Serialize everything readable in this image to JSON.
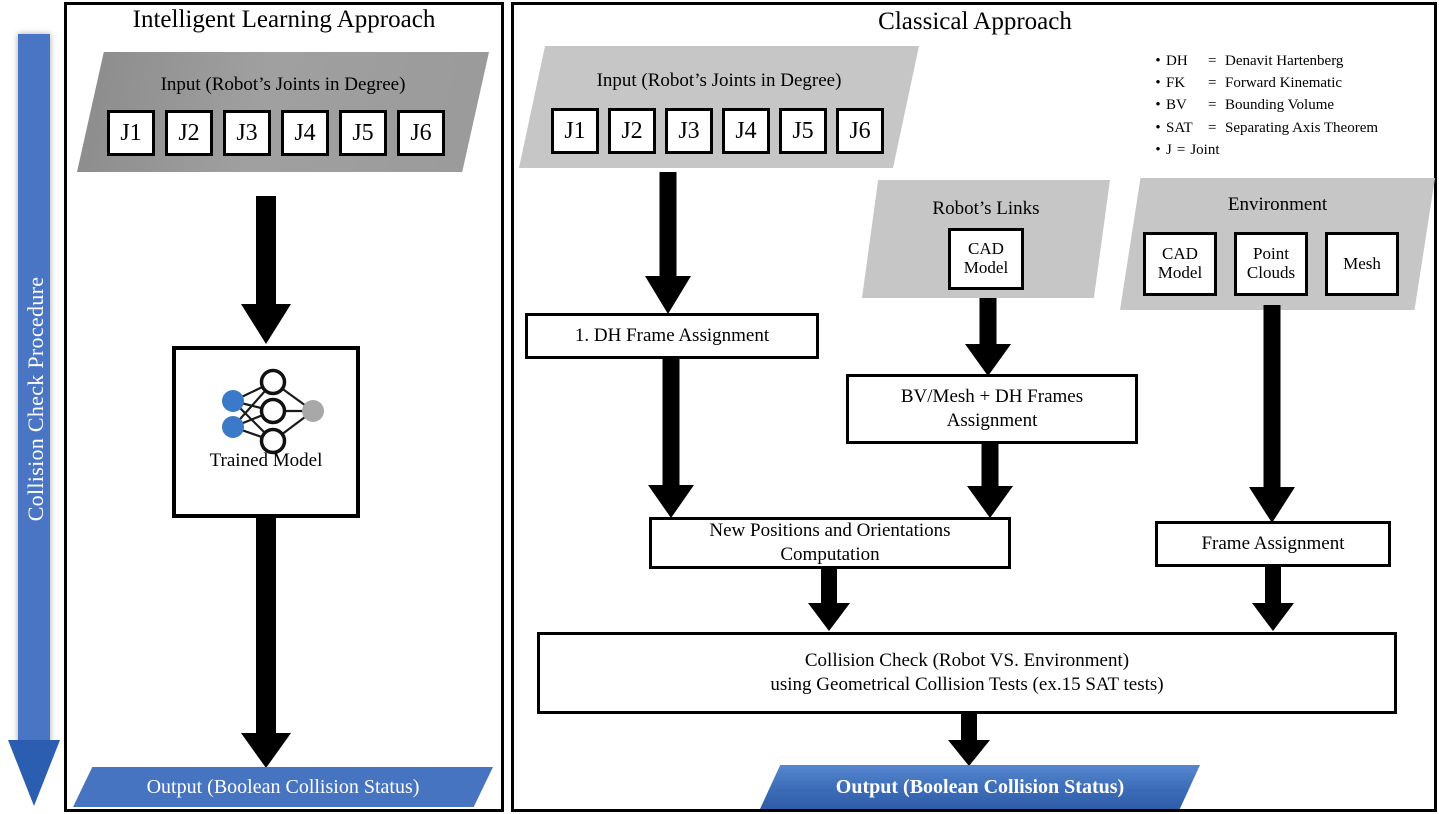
{
  "sidebar": {
    "label": "Collision Check Procedure",
    "color": "#4a74c4",
    "head_color": "#2b5eb0"
  },
  "left_panel": {
    "title": "Intelligent Learning Approach",
    "input": {
      "caption": "Input (Robot’s Joints in Degree)",
      "joints": [
        "J1",
        "J2",
        "J3",
        "J4",
        "J5",
        "J6"
      ]
    },
    "model": {
      "label": "Trained Model",
      "input_node_color": "#3a7ac8",
      "hidden_node_color": "#ffffff",
      "output_node_color": "#a8a8a8"
    },
    "output": {
      "label": "Output (Boolean Collision Status)",
      "color": "#4774c0"
    }
  },
  "right_panel": {
    "title": "Classical Approach",
    "input": {
      "caption": "Input (Robot’s Joints in Degree)",
      "joints": [
        "J1",
        "J2",
        "J3",
        "J4",
        "J5",
        "J6"
      ]
    },
    "robot_links": {
      "caption": "Robot’s Links",
      "items": [
        "CAD\nModel"
      ]
    },
    "environment": {
      "caption": "Environment",
      "items": [
        "CAD\nModel",
        "Point\nClouds",
        "Mesh"
      ]
    },
    "steps": {
      "dh_frame": "1. DH Frame Assignment",
      "bv_mesh": "BV/Mesh + DH Frames\nAssignment",
      "new_positions": "New Positions and Orientations\nComputation",
      "frame_assignment": "Frame Assignment",
      "collision_check": "Collision Check (Robot VS. Environment)\nusing Geometrical Collision Tests (ex.15 SAT tests)"
    },
    "output": {
      "label": "Output (Boolean Collision  Status)",
      "color": "#3c6cb8"
    }
  },
  "legend": {
    "items": [
      {
        "abbr": "DH",
        "eq": "=",
        "def": "Denavit Hartenberg"
      },
      {
        "abbr": "FK",
        "eq": "=",
        "def": "Forward Kinematic"
      },
      {
        "abbr": "BV",
        "eq": "=",
        "def": "Bounding Volume"
      },
      {
        "abbr": "SAT",
        "eq": "=",
        "def": "Separating Axis Theorem"
      },
      {
        "abbr": "J",
        "eq": "=",
        "def": "Joint"
      }
    ]
  }
}
